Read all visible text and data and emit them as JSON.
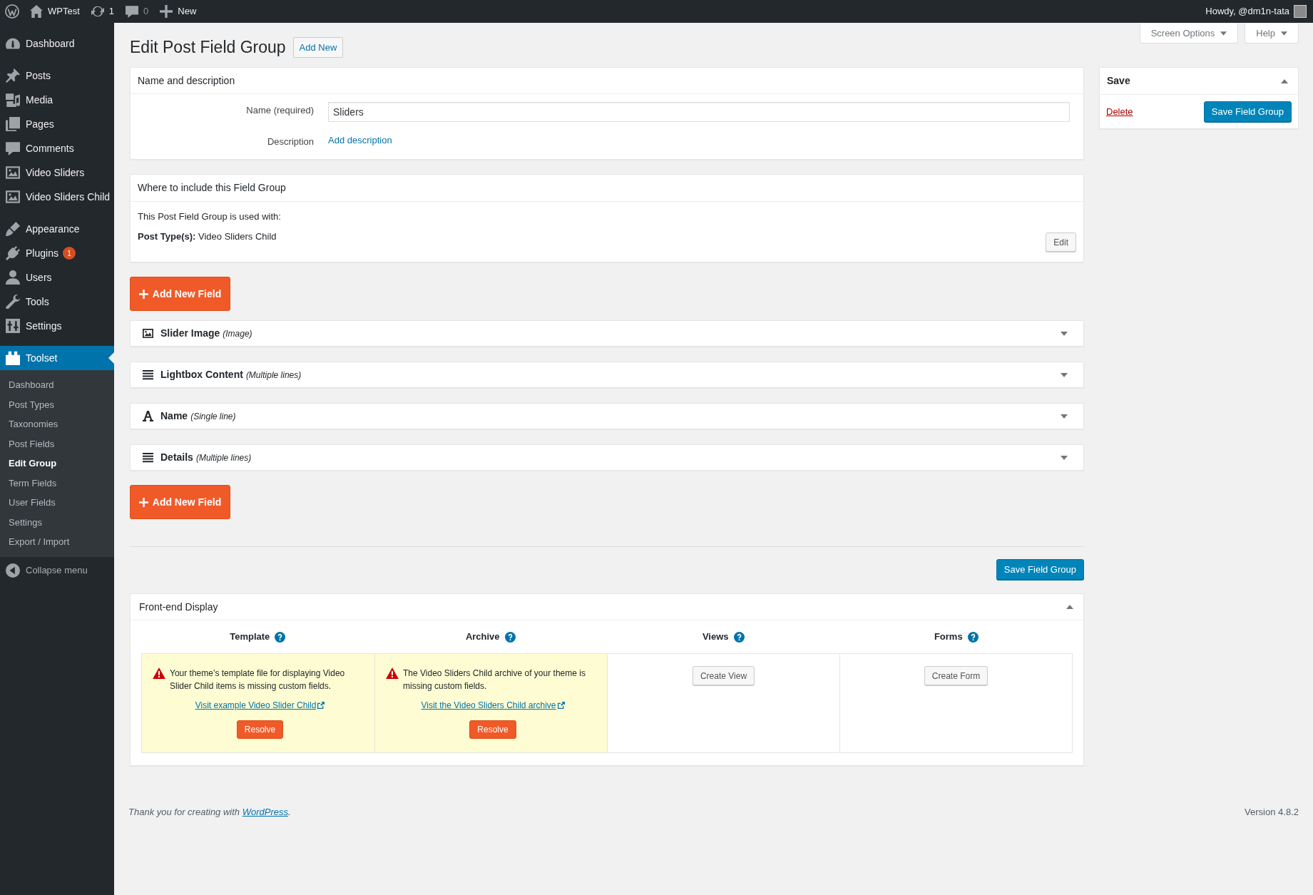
{
  "admin_bar": {
    "items": [
      {
        "kind": "logo"
      },
      {
        "kind": "site",
        "label": "WPTest"
      },
      {
        "kind": "updates",
        "label": "1"
      },
      {
        "kind": "comments",
        "label": "0"
      },
      {
        "kind": "new",
        "label": "New"
      }
    ],
    "greeting": "Howdy, @dm1n-tata"
  },
  "sidebar": {
    "sections": [
      {
        "items": [
          {
            "kind": "dashboard",
            "label": "Dashboard",
            "selected": false
          }
        ]
      },
      {
        "items": [
          {
            "kind": "posts",
            "label": "Posts",
            "selected": false
          },
          {
            "kind": "media",
            "label": "Media",
            "selected": false
          },
          {
            "kind": "pages",
            "label": "Pages",
            "selected": false
          },
          {
            "kind": "comments",
            "label": "Comments",
            "selected": false
          },
          {
            "kind": "post_type",
            "label": "Video Sliders",
            "selected": false
          },
          {
            "kind": "post_type",
            "label": "Video Sliders Child",
            "selected": false
          }
        ]
      },
      {
        "items": [
          {
            "kind": "appearance",
            "label": "Appearance",
            "selected": false
          },
          {
            "kind": "plugins",
            "label": "Plugins",
            "badge": "1",
            "selected": false
          },
          {
            "kind": "users",
            "label": "Users",
            "selected": false
          },
          {
            "kind": "tools",
            "label": "Tools",
            "selected": false
          },
          {
            "kind": "settings",
            "label": "Settings",
            "selected": false
          }
        ]
      },
      {
        "items": [
          {
            "kind": "toolset",
            "label": "Toolset",
            "selected": true,
            "children": [
              {
                "label": "Dashboard",
                "selected": false
              },
              {
                "label": "Post Types",
                "selected": false
              },
              {
                "label": "Taxonomies",
                "selected": false
              },
              {
                "label": "Post Fields",
                "selected": false
              },
              {
                "label": "Edit Group",
                "selected": true
              },
              {
                "label": "Term Fields",
                "selected": false
              },
              {
                "label": "User Fields",
                "selected": false
              },
              {
                "label": "Settings",
                "selected": false
              },
              {
                "label": "Export / Import",
                "selected": false
              }
            ]
          }
        ]
      }
    ],
    "collapse": "Collapse menu"
  },
  "screen_meta": [
    {
      "label": "Screen Options"
    },
    {
      "label": "Help"
    }
  ],
  "header": {
    "title": "Edit Post Field Group",
    "add_new": "Add New"
  },
  "name_panel": {
    "title": "Name and description",
    "name_label": "Name (required)",
    "name_value": "Sliders",
    "description_label": "Description",
    "description_link": "Add description"
  },
  "save_panel": {
    "title": "Save",
    "expanded": true,
    "delete": "Delete",
    "button": "Save Field Group"
  },
  "where_panel": {
    "title": "Where to include this Field Group",
    "intro": "This Post Field Group is used with:",
    "post_types": "**Post Type(s):** Video Sliders Child",
    "edit": "Edit"
  },
  "add_field_top": "Add New Field",
  "fields": [
    {
      "kind": "image",
      "name": "Slider Image",
      "type": "(Image)",
      "expanded": false
    },
    {
      "kind": "multiline",
      "name": "Lightbox Content",
      "type": "(Multiple lines)",
      "expanded": false
    },
    {
      "kind": "singleline",
      "name": "Name",
      "type": "(Single line)",
      "expanded": false
    },
    {
      "kind": "multiline",
      "name": "Details",
      "type": "(Multiple lines)",
      "expanded": false
    }
  ],
  "add_field_bottom": "Add New Field",
  "save_bottom": "Save Field Group",
  "frontend_display": {
    "title": "Front-end Display",
    "expanded": true,
    "columns": [
      {
        "kind": "warning",
        "heading": "Template",
        "message": "Your theme’s template file for displaying Video Slider Child items is missing custom fields.",
        "link": "Visit example Video Slider Child",
        "button": "Resolve"
      },
      {
        "kind": "warning",
        "heading": "Archive",
        "message": "The Video Sliders Child archive of your theme is missing custom fields.",
        "link": "Visit the Video Sliders Child archive",
        "button": "Resolve"
      },
      {
        "kind": "action",
        "heading": "Views",
        "button": "Create View"
      },
      {
        "kind": "action",
        "heading": "Forms",
        "button": "Create Form"
      }
    ]
  },
  "footer": {
    "before": "Thank you for creating with ",
    "link": "WordPress",
    "after": ".",
    "version": "Version 4.8.2"
  }
}
